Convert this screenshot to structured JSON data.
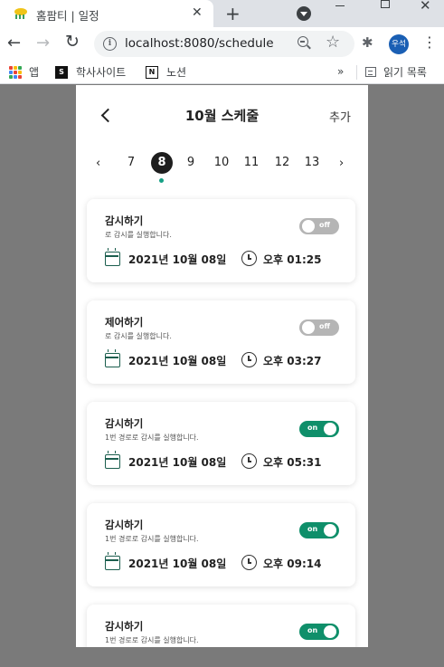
{
  "browser": {
    "tab_title": "홈팜티 | 일정",
    "tab_close": "✕",
    "new_tab": "+",
    "back": "←",
    "forward": "→",
    "reload": "↻",
    "info": "i",
    "url": "localhost:8080/schedule",
    "star": "☆",
    "extensions": "✱",
    "profile": "우석",
    "menu": "⋮",
    "win_close": "✕"
  },
  "bookmarks": {
    "items": [
      {
        "label": "앱",
        "icon": "apps-grid-icon"
      },
      {
        "label": "학사사이트",
        "icon": "s-logo-icon",
        "glyph": "S"
      },
      {
        "label": "노션",
        "icon": "notion-icon",
        "glyph": "N"
      }
    ],
    "more": "»",
    "reading_list": "읽기 목록"
  },
  "page": {
    "title": "10월 스케줄",
    "add_label": "추가"
  },
  "day_picker": {
    "prev": "‹",
    "next": "›",
    "days": [
      "7",
      "8",
      "9",
      "10",
      "11",
      "12",
      "13"
    ],
    "selected": "8"
  },
  "schedules": [
    {
      "title": "감시하기",
      "desc": "로 감시를 실행합니다.",
      "toggle": "off",
      "date": "2021년 10월 08일",
      "time": "오후 01:25"
    },
    {
      "title": "제어하기",
      "desc": "로 감시를 실행합니다.",
      "toggle": "off",
      "date": "2021년 10월 08일",
      "time": "오후 03:27"
    },
    {
      "title": "감시하기",
      "desc": "1번 경로로 감시를 실행합니다.",
      "toggle": "on",
      "date": "2021년 10월 08일",
      "time": "오후 05:31"
    },
    {
      "title": "감시하기",
      "desc": "1번 경로로 감시를 실행합니다.",
      "toggle": "on",
      "date": "2021년 10월 08일",
      "time": "오후 09:14"
    },
    {
      "title": "감시하기",
      "desc": "1번 경로로 감시를 실행합니다.",
      "toggle": "on",
      "date": "",
      "time": ""
    }
  ],
  "colors": {
    "toggle_on": "#0f8f6a",
    "toggle_off": "#b5b5b5",
    "accent_dot": "#16a085",
    "icon_green": "#1b5e4e",
    "backdrop": "#7a7a7a"
  }
}
